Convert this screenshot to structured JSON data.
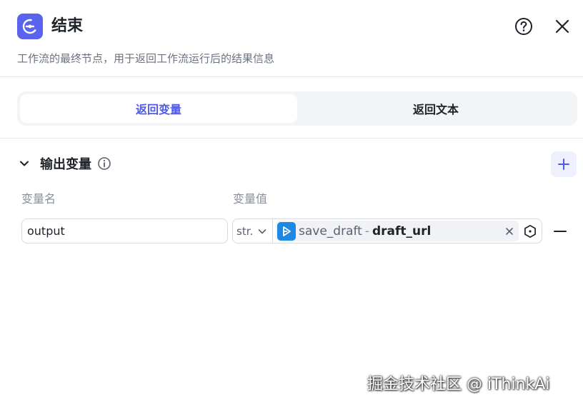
{
  "header": {
    "title": "结束",
    "description": "工作流的最终节点，用于返回工作流运行后的结果信息",
    "icons": {
      "node": "exit-icon",
      "help": "help-circle-icon",
      "close": "close-icon"
    }
  },
  "tabs": [
    {
      "label": "返回变量",
      "active": true
    },
    {
      "label": "返回文本",
      "active": false
    }
  ],
  "output_section": {
    "title": "输出变量",
    "col_name_label": "变量名",
    "col_value_label": "变量值",
    "rows": [
      {
        "name": "output",
        "type": "str.",
        "ref_node": "save_draft",
        "ref_separator": "-",
        "ref_var": "draft_url"
      }
    ]
  },
  "watermark": "掘金技术社区 @ iThinkAi",
  "colors": {
    "accent": "#4f5be8",
    "node_icon_bg": "#5a63f0",
    "ref_badge_bg": "#1e88e5"
  }
}
